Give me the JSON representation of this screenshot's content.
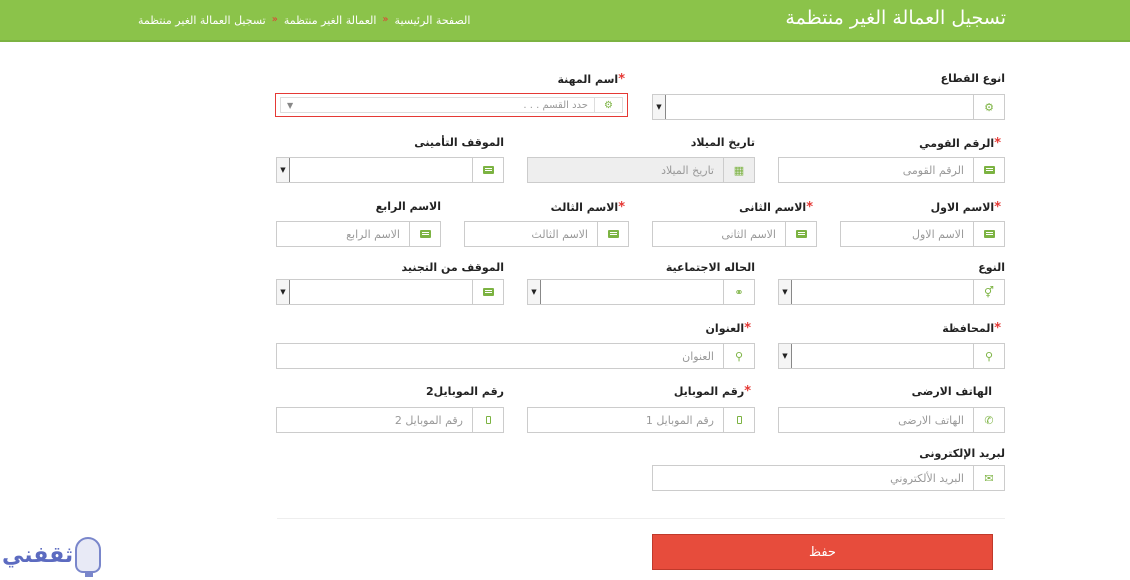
{
  "header": {
    "title": "تسجيل العمالة الغير منتظمة",
    "breadcrumb": [
      "الصفحة الرئيسية",
      "العمالة الغير منتظمة",
      "تسجيل العمالة الغير منتظمة"
    ],
    "separator": "«"
  },
  "required_mark": "*",
  "fields": {
    "sector": {
      "label": "انوع القطاع"
    },
    "profession": {
      "label": "اسم المهنة",
      "placeholder": "حدد القسم . . ."
    },
    "national_id": {
      "label": "الرقم القومي",
      "placeholder": "الرقم القومى"
    },
    "birth_date": {
      "label": "تاريخ الميلاد",
      "placeholder": "تاريخ الميلاد"
    },
    "insurance_status": {
      "label": "الموقف التأمينى"
    },
    "first_name": {
      "label": "الاسم الاول",
      "placeholder": "الاسم الاول"
    },
    "second_name": {
      "label": "الاسم الثانى",
      "placeholder": "الاسم الثانى"
    },
    "third_name": {
      "label": "الاسم الثالث",
      "placeholder": "الاسم الثالث"
    },
    "fourth_name": {
      "label": "الاسم الرابع",
      "placeholder": "الاسم الرابع"
    },
    "gender": {
      "label": "النوع"
    },
    "marital_status": {
      "label": "الحاله الاجتماعية"
    },
    "military_status": {
      "label": "الموقف من التجنيد"
    },
    "governorate": {
      "label": "المحافظة"
    },
    "address": {
      "label": "العنوان",
      "placeholder": "العنوان"
    },
    "landline": {
      "label": "الهاتف الارضى",
      "placeholder": "الهاتف الارضى"
    },
    "mobile": {
      "label": "رقم الموبايل",
      "placeholder": "رقم الموبايل 1"
    },
    "mobile2": {
      "label": "رقم الموبايل2",
      "placeholder": "رقم الموبايل 2"
    },
    "email": {
      "label": "لبريد الإلكترونى",
      "placeholder": "البريد الألكتروني"
    }
  },
  "save_label": "حفظ",
  "logo_text": "ثقفني",
  "icons": {
    "sector": "cogs-icon",
    "profession": "cogs-icon",
    "id": "id-card-icon",
    "birth": "calendar-icon",
    "gender": "gender-icon",
    "marital": "rings-icon",
    "location": "map-pin-icon",
    "phone": "phone-icon",
    "mobile": "mobile-icon",
    "email": "envelope-icon"
  },
  "colors": {
    "header": "#8bc34a",
    "accent": "#7cb342",
    "required": "#e53935",
    "save": "#e74c3c"
  }
}
